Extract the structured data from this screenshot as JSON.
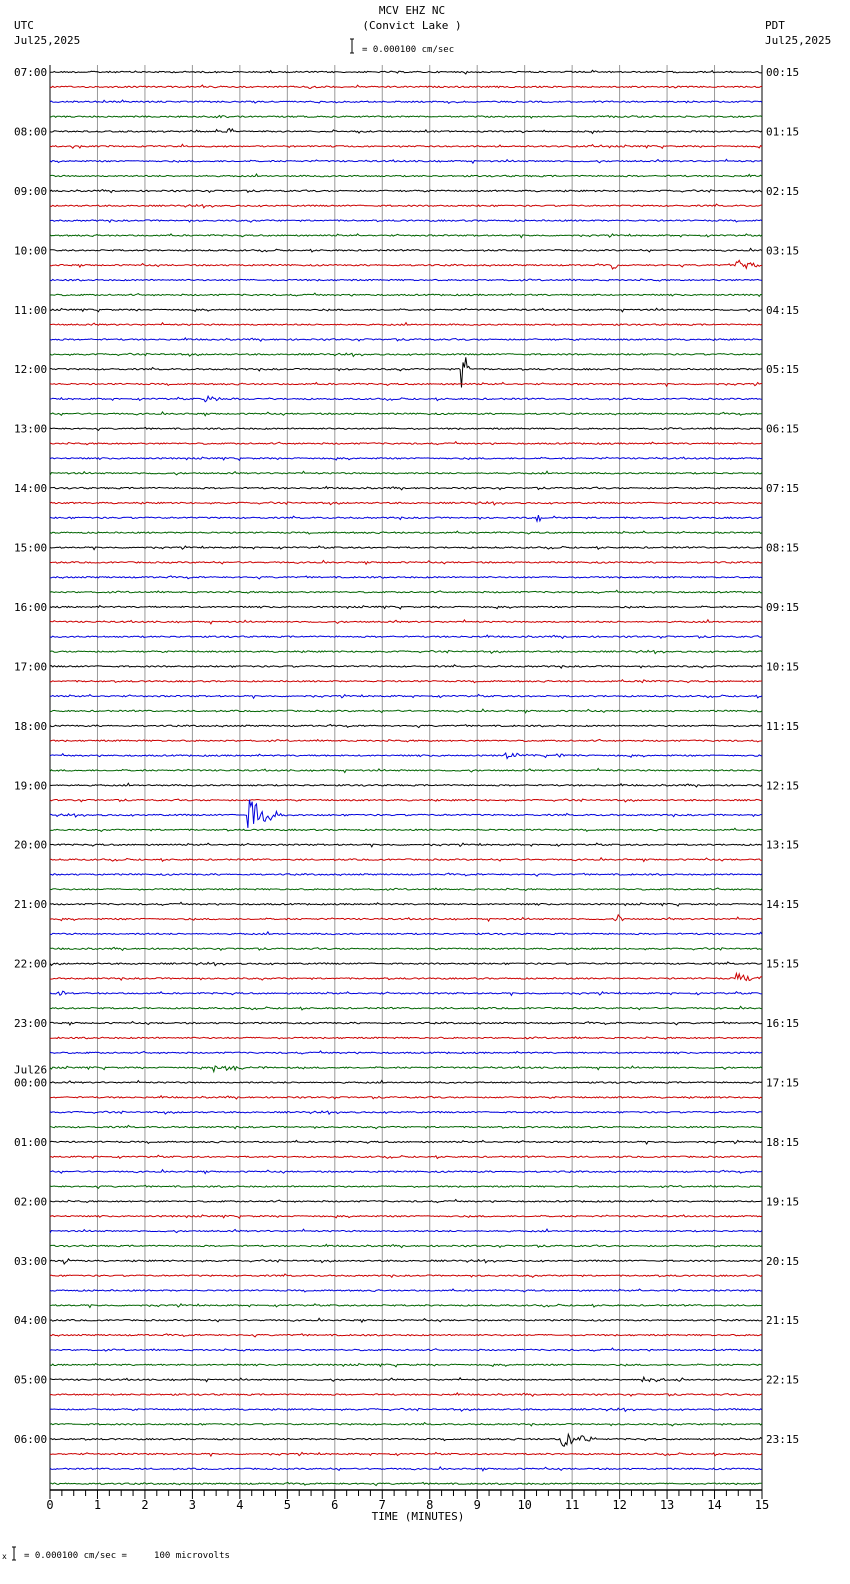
{
  "header": {
    "station": "MCV EHZ NC",
    "location": "(Convict Lake )",
    "scale": "= 0.000100 cm/sec",
    "left_tz": "UTC",
    "left_date": "Jul25,2025",
    "right_tz": "PDT",
    "right_date": "Jul25,2025"
  },
  "footer": {
    "scale_note": "= 0.000100 cm/sec =     100 microvolts",
    "marker": "x"
  },
  "chart_data": {
    "type": "line",
    "title": "MCV EHZ NC (Convict Lake )",
    "xlabel": "TIME (MINUTES)",
    "xlim": [
      0,
      15
    ],
    "x_ticks": [
      "0",
      "1",
      "2",
      "3",
      "4",
      "5",
      "6",
      "7",
      "8",
      "9",
      "10",
      "11",
      "12",
      "13",
      "14",
      "15"
    ],
    "rows_per_hour": 4,
    "trace_colors": [
      "#000000",
      "#cc0000",
      "#0000dd",
      "#006400"
    ],
    "date_change_label": "Jul26",
    "left_labels": [
      "07:00",
      "08:00",
      "09:00",
      "10:00",
      "11:00",
      "12:00",
      "13:00",
      "14:00",
      "15:00",
      "16:00",
      "17:00",
      "18:00",
      "19:00",
      "20:00",
      "21:00",
      "22:00",
      "23:00",
      "00:00",
      "01:00",
      "02:00",
      "03:00",
      "04:00",
      "05:00",
      "06:00"
    ],
    "right_labels": [
      "00:15",
      "01:15",
      "02:15",
      "03:15",
      "04:15",
      "05:15",
      "06:15",
      "07:15",
      "08:15",
      "09:15",
      "10:15",
      "11:15",
      "12:15",
      "13:15",
      "14:15",
      "15:15",
      "16:15",
      "17:15",
      "18:15",
      "19:15",
      "20:15",
      "21:15",
      "22:15",
      "23:15"
    ],
    "events": [
      {
        "row": 1,
        "minute": 5.5,
        "amplitude": 2,
        "duration": 0.1
      },
      {
        "row": 3,
        "minute": 3.5,
        "amplitude": 2,
        "duration": 0.4
      },
      {
        "row": 4,
        "minute": 3.8,
        "amplitude": 4,
        "duration": 0.1
      },
      {
        "row": 13,
        "minute": 11.9,
        "amplitude": 5,
        "duration": 0.15
      },
      {
        "row": 13,
        "minute": 14.5,
        "amplitude": 7,
        "duration": 0.5
      },
      {
        "row": 20,
        "minute": 8.7,
        "amplitude": 30,
        "duration": 0.15
      },
      {
        "row": 22,
        "minute": 3.3,
        "amplitude": 4,
        "duration": 0.8
      },
      {
        "row": 30,
        "minute": 10.3,
        "amplitude": 4,
        "duration": 0.1
      },
      {
        "row": 41,
        "minute": 12.5,
        "amplitude": 2,
        "duration": 0.2
      },
      {
        "row": 46,
        "minute": 9.6,
        "amplitude": 3,
        "duration": 0.6
      },
      {
        "row": 46,
        "minute": 10.7,
        "amplitude": 3,
        "duration": 0.5
      },
      {
        "row": 50,
        "minute": 4.2,
        "amplitude": 20,
        "duration": 0.8
      },
      {
        "row": 57,
        "minute": 12.0,
        "amplitude": 5,
        "duration": 0.15
      },
      {
        "row": 61,
        "minute": 14.5,
        "amplitude": 5,
        "duration": 0.8
      },
      {
        "row": 62,
        "minute": 0.2,
        "amplitude": 3,
        "duration": 0.4
      },
      {
        "row": 67,
        "minute": 3.5,
        "amplitude": 4,
        "duration": 1.2
      },
      {
        "row": 80,
        "minute": 0.3,
        "amplitude": 3,
        "duration": 0.3
      },
      {
        "row": 88,
        "minute": 12.5,
        "amplitude": 3,
        "duration": 1.0
      },
      {
        "row": 92,
        "minute": 10.8,
        "amplitude": 10,
        "duration": 0.8
      }
    ]
  }
}
